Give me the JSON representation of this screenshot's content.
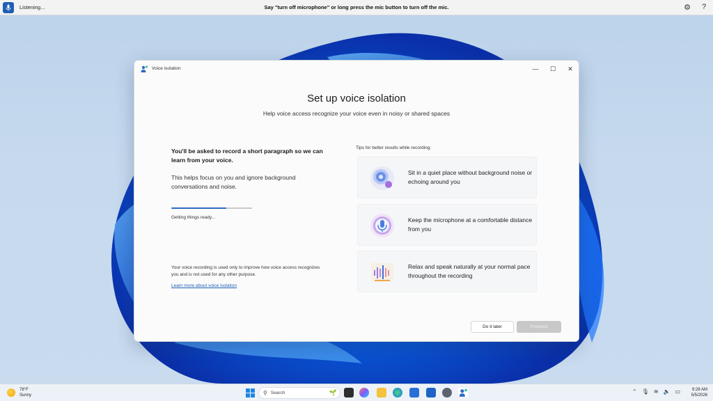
{
  "voice_bar": {
    "status": "Listening...",
    "hint": "Say \"turn off microphone\" or long press the mic button to turn off the mic.",
    "icons": [
      "microphone-icon",
      "settings-icon",
      "help-icon"
    ],
    "help_glyph": "?"
  },
  "dialog": {
    "title": "Voice isolation",
    "heading": "Set up voice isolation",
    "subheading": "Help voice access recognize your voice even in noisy or shared spaces",
    "intro_bold": "You'll be asked to record a short paragraph so we can learn from your voice.",
    "intro_body": "This helps focus on you and ignore background conversations and noise.",
    "progress": {
      "fraction": 0.68,
      "label": "Getting things ready..."
    },
    "privacy_note": "Your voice recording is used only to improve how voice access recognizes you and is not used for any other purpose.",
    "learn_more": "Learn more about voice isolation",
    "tips_label": "Tips for better results while recording:",
    "tips": [
      {
        "text": "Sit in a quiet place without background noise or echoing around you",
        "icon": "quiet-place-icon"
      },
      {
        "text": "Keep the microphone at a comfortable distance from you",
        "icon": "microphone-distance-icon"
      },
      {
        "text": "Relax and speak naturally at your normal pace throughout the recording",
        "icon": "speak-naturally-icon"
      }
    ],
    "buttons": {
      "later": "Do it later",
      "proceed": "Proceed"
    },
    "window_controls": {
      "minimize": "—",
      "maximize": "☐",
      "close": "✕"
    }
  },
  "taskbar": {
    "weather": {
      "temp": "78°F",
      "condition": "Sunny"
    },
    "search_placeholder": "Search",
    "clock": {
      "time": "9:28 AM",
      "date": "5/5/2026"
    },
    "colors": {
      "accent": "#1f5fb4",
      "start": "#1f86e0"
    }
  }
}
